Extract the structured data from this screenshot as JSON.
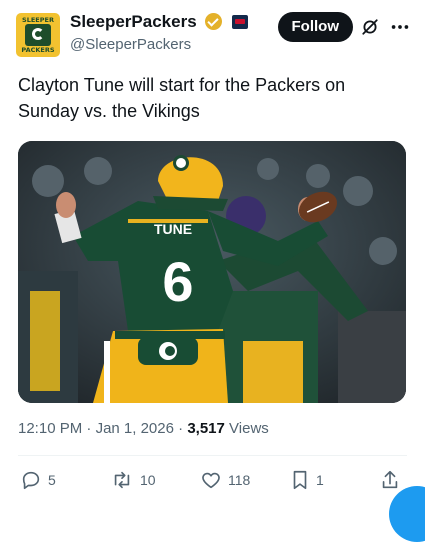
{
  "account": {
    "display_name": "SleeperPackers",
    "handle": "@SleeperPackers",
    "logo_top_text": "SLEEPER",
    "logo_bottom_text": "PACKERS"
  },
  "follow_label": "Follow",
  "tweet": {
    "text": "Clayton Tune will start for the Packers on Sunday vs. the Vikings",
    "time": "12:10 PM",
    "date": "Jan 1, 2026",
    "views_count": "3,517",
    "views_label": "Views",
    "sep": "·"
  },
  "media": {
    "jersey_name": "TUNE",
    "jersey_number": "6"
  },
  "actions": {
    "replies": "5",
    "reposts": "10",
    "likes": "118",
    "bookmarks": "1"
  },
  "colors": {
    "accent": "#1d9bf0",
    "packers_green": "#203731",
    "packers_gold": "#FFB612"
  }
}
